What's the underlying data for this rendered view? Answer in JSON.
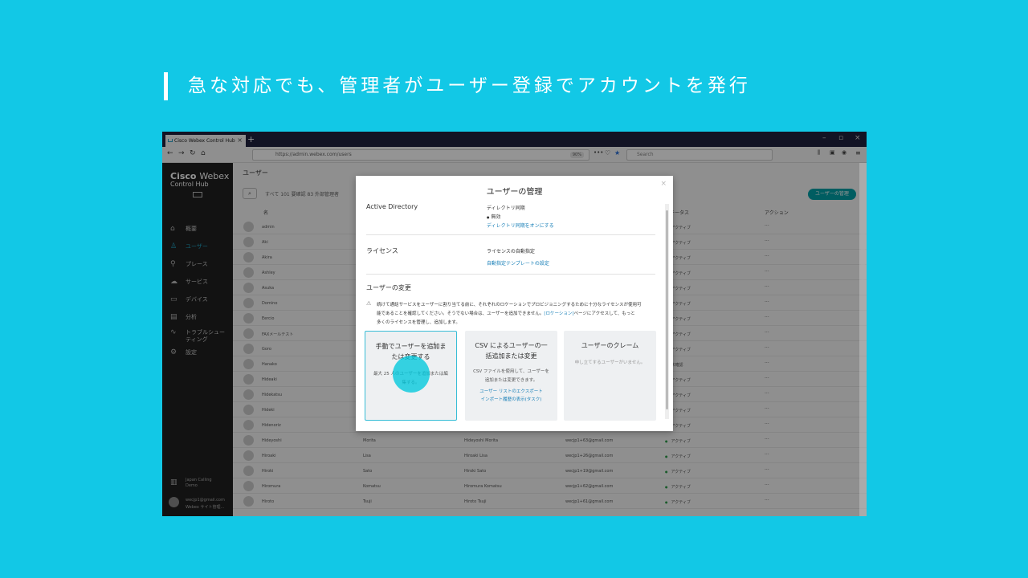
{
  "headline": "急な対応でも、管理者がユーザー登録でアカウントを発行",
  "browser": {
    "tab_title": "Cisco Webex Control Hub",
    "url": "https://admin.webex.com/users",
    "zoom": "90%",
    "search_placeholder": "Search"
  },
  "sidebar": {
    "brand_line1": "Cisco",
    "brand_line1b": "Webex",
    "brand_line2": "Control Hub",
    "items": [
      {
        "icon": "home-icon",
        "label": "概要"
      },
      {
        "icon": "user-icon",
        "label": "ユーザー"
      },
      {
        "icon": "location-icon",
        "label": "プレース"
      },
      {
        "icon": "cloud-icon",
        "label": "サービス"
      },
      {
        "icon": "device-icon",
        "label": "デバイス"
      },
      {
        "icon": "chart-icon",
        "label": "分析"
      },
      {
        "icon": "pulse-icon",
        "label": "トラブルシュー"
      },
      {
        "icon": "pulse-icon",
        "label": "ティング"
      },
      {
        "icon": "gear-icon",
        "label": "設定"
      }
    ],
    "org_name_1": "Japan Calling",
    "org_name_2": "Demo",
    "user_email": "wecjp1@gmail.com",
    "user_sub": "Webex サイト管理..."
  },
  "main": {
    "title": "ユーザー",
    "filter": "すべて 101  要確認 83  外部管理者",
    "manage_button": "ユーザーの管理",
    "col_name": "名",
    "col_status": "ステータス",
    "col_actions": "アクション",
    "rows": [
      {
        "first": "admin",
        "last": "",
        "display": "",
        "email": "",
        "status": "アクティブ"
      },
      {
        "first": "Aki",
        "last": "",
        "display": "",
        "email": "",
        "status": "アクティブ"
      },
      {
        "first": "Akira",
        "last": "",
        "display": "",
        "email": "",
        "status": "アクティブ"
      },
      {
        "first": "Ashley",
        "last": "",
        "display": "",
        "email": "",
        "status": "アクティブ"
      },
      {
        "first": "Asuka",
        "last": "",
        "display": "",
        "email": "",
        "status": "アクティブ"
      },
      {
        "first": "Domino",
        "last": "",
        "display": "",
        "email": "",
        "status": "アクティブ"
      },
      {
        "first": "Eercio",
        "last": "",
        "display": "",
        "email": "",
        "status": "アクティブ"
      },
      {
        "first": "FAXメールテスト",
        "last": "",
        "display": "",
        "email": "",
        "status": "アクティブ"
      },
      {
        "first": "Goro",
        "last": "",
        "display": "",
        "email": "",
        "status": "アクティブ"
      },
      {
        "first": "Hanako",
        "last": "",
        "display": "",
        "email": "",
        "status": "未確認"
      },
      {
        "first": "Hideaki",
        "last": "",
        "display": "",
        "email": "",
        "status": "アクティブ"
      },
      {
        "first": "Hidekatsu",
        "last": "",
        "display": "",
        "email": "",
        "status": "アクティブ"
      },
      {
        "first": "Hideki",
        "last": "",
        "display": "",
        "email": "",
        "status": "アクティブ"
      },
      {
        "first": "Hidenoriz",
        "last": "",
        "display": "",
        "email": "",
        "status": "アクティブ"
      },
      {
        "first": "Hideyoshi",
        "last": "Morita",
        "display": "Hideyoshi Morita",
        "email": "wecjp1+63@gmail.com",
        "status": "アクティブ"
      },
      {
        "first": "Hiroaki",
        "last": "Lisa",
        "display": "Hiroaki Lisa",
        "email": "wecjp1+26@gmail.com",
        "status": "アクティブ"
      },
      {
        "first": "Hiroki",
        "last": "Sato",
        "display": "Hiroki Sato",
        "email": "wecjp1+19@gmail.com",
        "status": "アクティブ"
      },
      {
        "first": "Hiromura",
        "last": "Komatsu",
        "display": "Hiromura Komatsu",
        "email": "wecjp1+62@gmail.com",
        "status": "アクティブ"
      },
      {
        "first": "Hiroto",
        "last": "Tsuji",
        "display": "Hiroto Tsuji",
        "email": "wecjp1+61@gmail.com",
        "status": "アクティブ"
      }
    ]
  },
  "modal": {
    "title": "ユーザーの管理",
    "ad_label": "Active Directory",
    "ad_sync_title": "ディレクトリ同期",
    "ad_sync_state": "無効",
    "ad_sync_link": "ディレクトリ同期をオンにする",
    "license_label": "ライセンス",
    "license_auto": "ライセンスの自動指定",
    "license_link": "自動指定テンプレートの設定",
    "change_label": "ユーザーの変更",
    "warning_1": "続けて通話サービスをユーザーに割り当てる前に、それぞれのロケーションでプロビジョニングするために十分なライセンスが使用可",
    "warning_2a": "能であることを確認してください。そうでない場合は、ユーザーを追加できません。",
    "warning_2_link": "[ロケーション]",
    "warning_2b": "ページにアクセスして、もっと",
    "warning_3": "多くのライセンスを管理し、追加します。",
    "cards": [
      {
        "title": "手動でユーザーを追加または変更する",
        "desc": "最大 25 人のユーザーを追加または編集する。",
        "link1": "",
        "link2": ""
      },
      {
        "title": "CSV によるユーザーの一括追加または変更",
        "desc": "CSV ファイルを使用して、ユーザーを追加または変更できます。",
        "link1": "ユーザー リストのエクスポート",
        "link2": "インポート履歴の表示(タスク)"
      },
      {
        "title": "ユーザーのクレーム",
        "desc": "申し立てするユーザーがいません。",
        "link1": "",
        "link2": ""
      }
    ]
  },
  "colors": {
    "background": "#12c8e6",
    "accent": "#00a0a8",
    "link": "#1a80b8"
  }
}
